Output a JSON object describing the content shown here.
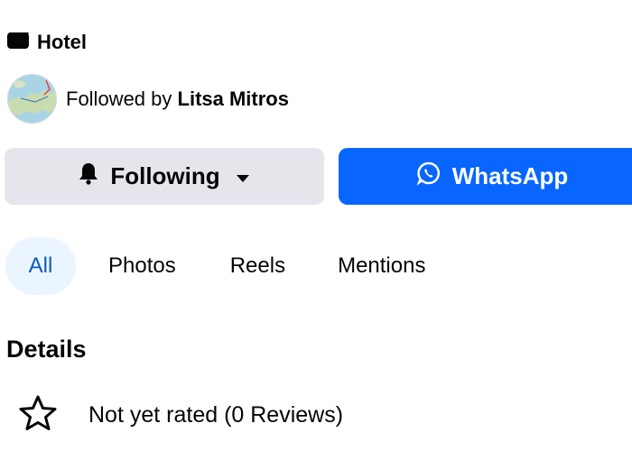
{
  "header": {
    "category_icon": "clapperboard-icon",
    "category": "Hotel",
    "followed_prefix": "Followed by ",
    "followed_name": "Litsa Mitros",
    "avatar": "map-avatar"
  },
  "actions": {
    "following_label": "Following",
    "following_icons": [
      "bell-icon",
      "caret-down-icon"
    ],
    "whatsapp_label": "WhatsApp",
    "whatsapp_icon": "whatsapp-icon"
  },
  "tabs": [
    {
      "label": "All",
      "active": true
    },
    {
      "label": "Photos",
      "active": false
    },
    {
      "label": "Reels",
      "active": false
    },
    {
      "label": "Mentions",
      "active": false
    }
  ],
  "details": {
    "heading": "Details",
    "rating_icon": "star-outline-icon",
    "rating_text": "Not yet rated (0 Reviews)"
  },
  "colors": {
    "primary": "#0866ff",
    "secondary_button": "#e4e6eb",
    "active_tab_bg": "#ebf5ff",
    "active_tab_text": "#0a5ac2"
  }
}
